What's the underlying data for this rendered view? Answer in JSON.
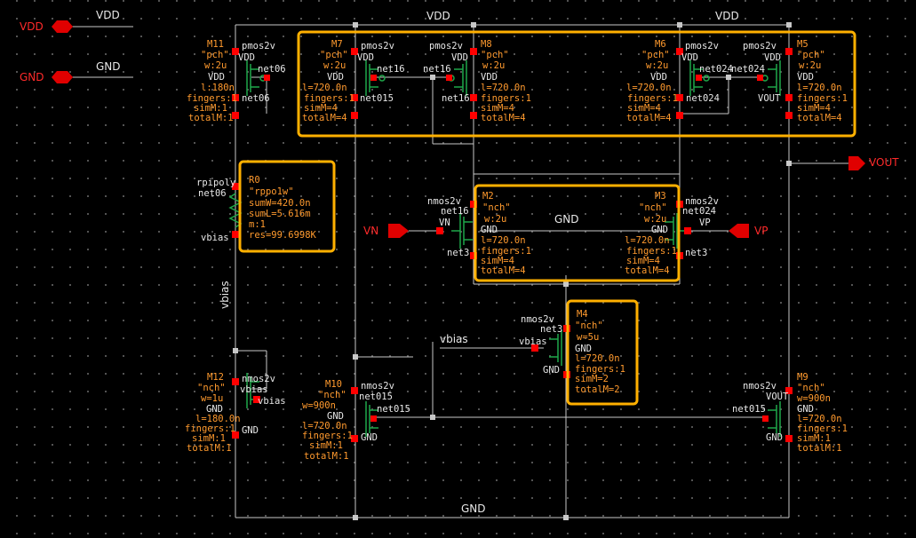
{
  "pins": {
    "vdd": "VDD",
    "gnd": "GND",
    "vn": "VN",
    "vp": "VP",
    "vout": "VOUT"
  },
  "nets": {
    "vdd_left": "VDD",
    "gnd_left": "GND",
    "vdd_top_mid": "VDD",
    "vdd_top_right": "VDD",
    "gnd_mid": "GND",
    "gnd_bottom": "GND",
    "vbias_wire": "vbias",
    "vbias_vertical": "vbias"
  },
  "colors": {
    "wire": "#c8c8c8",
    "pin": "#ff2020",
    "device": "#1fa84a",
    "highlight": "#ffb000",
    "terminal": "#ff0000"
  },
  "devices": {
    "M11": {
      "type": "pmos2v",
      "name": "M11",
      "model": "\"pch\"",
      "w": "w:2u",
      "l": "l:180n",
      "fingers": "fingers:1",
      "simM": "simM:1",
      "totalM": "totalM:1",
      "vdd1": "VDD",
      "vdd2": "VDD",
      "net_r": "net06",
      "net_b": "net06"
    },
    "M7": {
      "type": "pmos2v",
      "name": "M7",
      "model": "\"pch\"",
      "w": "w:2u",
      "l": "l=720.0n",
      "fingers": "fingers:1",
      "simM": "simM=4",
      "totalM": "totalM=4",
      "vdd1": "VDD",
      "vdd2": "VDD",
      "net_r": "net16",
      "net_b": "net015"
    },
    "M8": {
      "type": "pmos2v",
      "name": "M8",
      "model": "\"pch\"",
      "w": "w:2u",
      "l": "l=720.0n",
      "fingers": "fingers:1",
      "simM": "simM=4",
      "totalM": "totalM=4",
      "vdd1": "VDD",
      "vdd2": "VDD",
      "net_l": "net16",
      "net_b": "net16"
    },
    "M6": {
      "type": "pmos2v",
      "name": "M6",
      "model": "\"pch\"",
      "w": "w:2u",
      "l": "l=720.0n",
      "fingers": "fingers:1",
      "simM": "simM=4",
      "totalM": "totalM=4",
      "vdd1": "VDD",
      "vdd2": "VDD",
      "net_r": "net024",
      "net_b": "net024"
    },
    "M5": {
      "type": "pmos2v",
      "name": "M5",
      "model": "\"pch\"",
      "w": "w:2u",
      "l": "l=720.0n",
      "fingers": "fingers:1",
      "simM": "simM=4",
      "totalM": "totalM=4",
      "vdd1": "VDD",
      "vdd2": "VDD",
      "net_l": "net024",
      "net_b": "VOUT"
    },
    "R0": {
      "type": "rpipoly",
      "name": "R0",
      "model": "\"rppo1w\"",
      "sumW": "sumW=420.0n",
      "sumL": "sumL=5.616m",
      "m": "m:1",
      "res": "res=99.6998K",
      "net_t": "net06",
      "net_b": "vbias"
    },
    "M2": {
      "type": "nmos2v",
      "name": "M2",
      "model": "\"nch\"",
      "w": "w:2u",
      "l": "l=720.0n",
      "fingers": "fingers:1",
      "simM": "simM=4",
      "totalM": "totalM=4",
      "net_t": "net16",
      "gate": "VN",
      "body": "GND",
      "net_b": "net3"
    },
    "M3": {
      "type": "nmos2v",
      "name": "M3",
      "model": "\"nch\"",
      "w": "w:2u",
      "l": "l=720.0n",
      "fingers": "fingers:1",
      "simM": "simM=4",
      "totalM": "totalM=4",
      "net_t": "net024",
      "gate": "VP",
      "body": "GND",
      "net_b": "net3"
    },
    "M4": {
      "type": "nmos2v",
      "name": "M4",
      "model": "\"nch\"",
      "w": "w=5u",
      "l": "l=720.0n",
      "fingers": "fingers:1",
      "simM": "simM=2",
      "totalM": "totalM=2",
      "net_t": "net3",
      "gate": "vbias",
      "body": "GND",
      "net_b": "GND"
    },
    "M12": {
      "type": "nmos2v",
      "name": "M12",
      "model": "\"nch\"",
      "w": "w=1u",
      "l": "l=180.0n",
      "fingers": "fingers:1",
      "simM": "simM:1",
      "totalM": "totalM:1",
      "net_t": "vbias",
      "gate": "vbias",
      "body": "GND",
      "net_b": "GND"
    },
    "M10": {
      "type": "nmos2v",
      "name": "M10",
      "model": "\"nch\"",
      "w": "w=900n",
      "l": "l=720.0n",
      "fingers": "fingers:1",
      "simM": "simM:1",
      "totalM": "totalM:1",
      "net_t": "net015",
      "gate": "net015",
      "body": "GND",
      "net_b": "GND"
    },
    "M9": {
      "type": "nmos2v",
      "name": "M9",
      "model": "\"nch\"",
      "w": "w=900n",
      "l": "l=720.0n",
      "fingers": "fingers:1",
      "simM": "simM:1",
      "totalM": "totalM:1",
      "net_t": "VOUT",
      "gate": "net015",
      "body": "GND",
      "net_b": "GND"
    }
  }
}
